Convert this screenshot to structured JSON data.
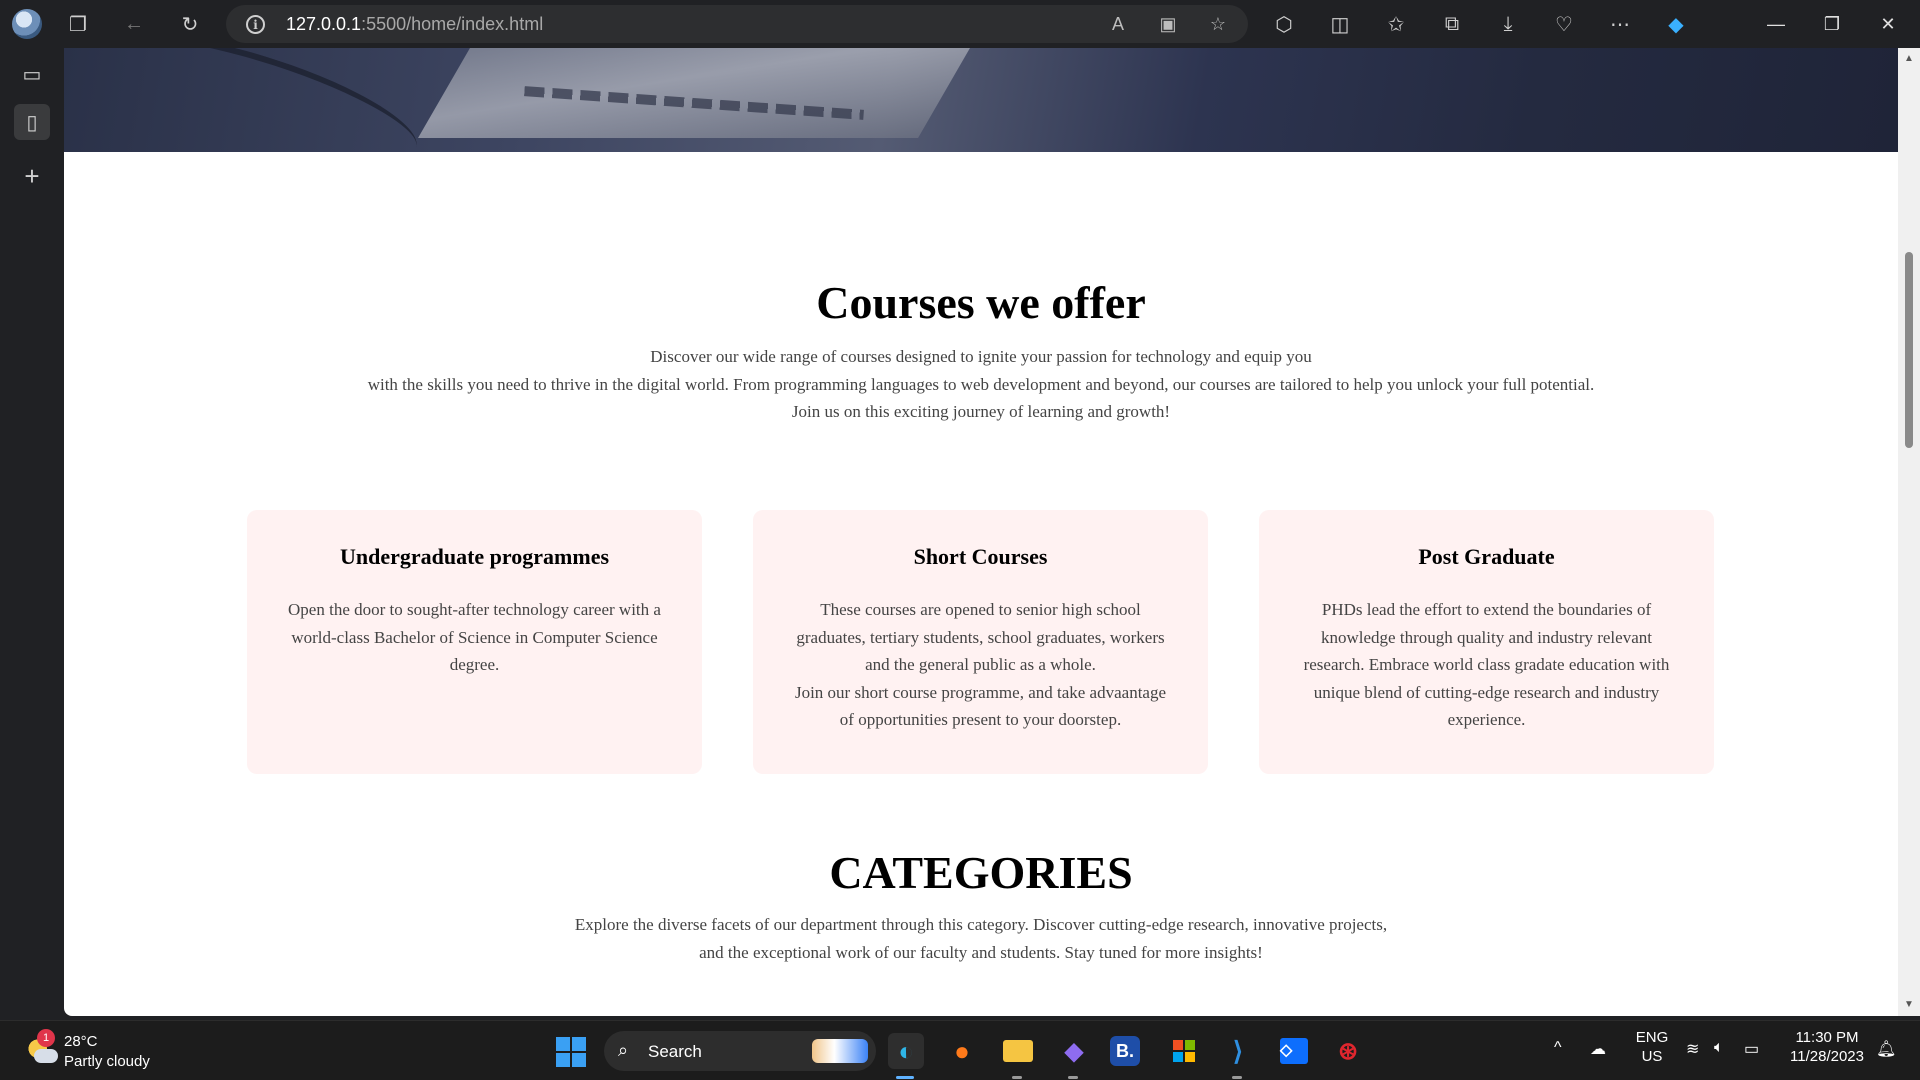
{
  "browser": {
    "url_host": "127.0.0.1",
    "url_rest": ":5500/home/index.html"
  },
  "courses": {
    "title": "Courses we offer",
    "description": [
      "Discover our wide range of courses designed to ignite your passion for technology and equip you",
      "with the skills you need to thrive in the digital world. From programming languages to web development and beyond, our courses are tailored to help you unlock your full potential.",
      "Join us on this exciting journey of learning and growth!"
    ],
    "cards": [
      {
        "title": "Undergraduate programmes",
        "lines": [
          "Open the door to sought-after technology career with a",
          "world-class Bachelor of Science in Computer Science",
          "degree."
        ]
      },
      {
        "title": "Short Courses",
        "lines": [
          "These courses are opened to senior high school",
          "graduates, tertiary students, school graduates, workers",
          "and the general public as a whole.",
          "Join our short course programme, and take advaantage",
          "of opportunities present to your doorstep."
        ]
      },
      {
        "title": "Post Graduate",
        "lines": [
          "PHDs lead the effort to extend the boundaries of",
          "knowledge through quality and industry relevant",
          "research. Embrace world class gradate education with",
          "unique blend of cutting-edge research and industry",
          "experience."
        ]
      }
    ]
  },
  "categories": {
    "title": "CATEGORIES",
    "description": [
      "Explore the diverse facets of our department through this category. Discover cutting-edge research, innovative projects,",
      "and the exceptional work of our faculty and students. Stay tuned for more insights!"
    ]
  },
  "taskbar": {
    "weather_temp": "28°C",
    "weather_condition": "Partly cloudy",
    "weather_badge": "1",
    "search_label": "Search",
    "lang_line1": "ENG",
    "lang_line2": "US",
    "time": "11:30 PM",
    "date": "11/28/2023"
  },
  "icons": {
    "accent_blue": "#3aa0f3",
    "card_background": "#fff2f2"
  }
}
